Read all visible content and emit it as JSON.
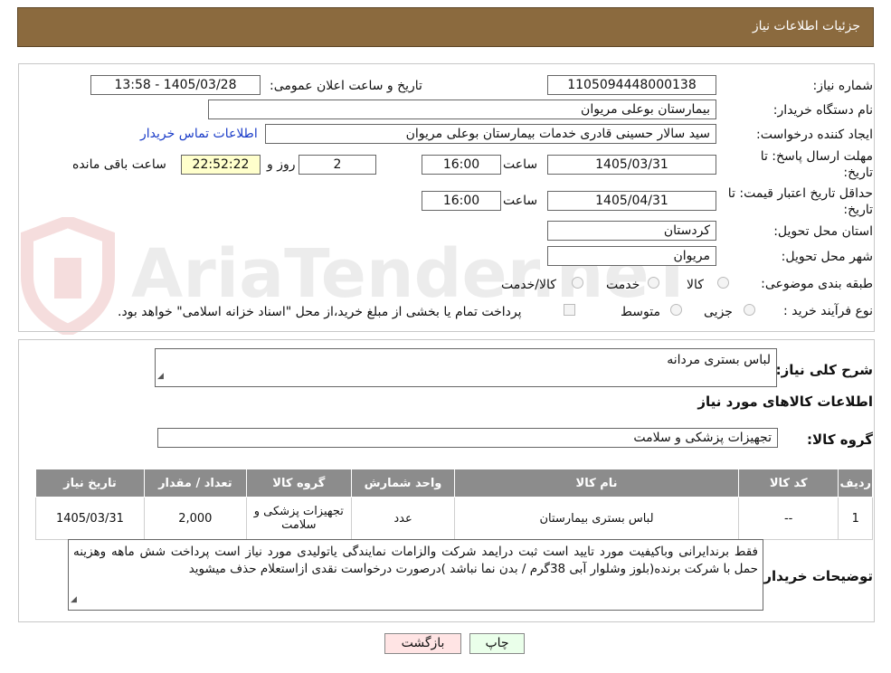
{
  "header": {
    "title": "جزئیات اطلاعات نیاز"
  },
  "watermark": {
    "text": "AriaTender.neT"
  },
  "form": {
    "need_number_label": "شماره نیاز:",
    "need_number": "1105094448000138",
    "announce_label": "تاریخ و ساعت اعلان عمومی:",
    "announce_value": "1405/03/28 - 13:58",
    "buyer_org_label": "نام دستگاه خریدار:",
    "buyer_org": "بیمارستان بوعلی مریوان",
    "requester_label": "ایجاد کننده درخواست:",
    "requester": "سید سالار حسینی قادری خدمات بیمارستان بوعلی مریوان",
    "contact_link": "اطلاعات تماس خریدار",
    "deadline_label_1": "مهلت ارسال پاسخ: تا",
    "deadline_label_2": "تاریخ:",
    "deadline_date": "1405/03/31",
    "time_label": "ساعت",
    "deadline_time": "16:00",
    "days_value": "2",
    "days_label": "روز و",
    "remaining_time": "22:52:22",
    "remaining_label": "ساعت باقی مانده",
    "validity_label_1": "حداقل تاریخ اعتبار قیمت: تا",
    "validity_label_2": "تاریخ:",
    "validity_date": "1405/04/31",
    "validity_time": "16:00",
    "province_label": "استان محل تحویل:",
    "province": "کردستان",
    "city_label": "شهر محل تحویل:",
    "city": "مریوان",
    "category_label": "طبقه بندی موضوعی:",
    "category_options": [
      "کالا",
      "خدمت",
      "کالا/خدمت"
    ],
    "process_label": "نوع فرآیند خرید :",
    "process_options": [
      "جزیی",
      "متوسط"
    ],
    "payment_note": "پرداخت تمام یا بخشی از مبلغ خرید،از محل \"اسناد خزانه اسلامی\" خواهد بود."
  },
  "summary": {
    "desc_label": "شرح کلی نیاز:",
    "desc_value": "لباس بستری مردانه",
    "goods_info_title": "اطلاعات کالاهای مورد نیاز",
    "group_label": "گروه کالا:",
    "group_value": "تجهیزات پزشکی و سلامت"
  },
  "table": {
    "headers": [
      "ردیف",
      "کد کالا",
      "نام کالا",
      "واحد شمارش",
      "گروه کالا",
      "تعداد / مقدار",
      "تاریخ نیاز"
    ],
    "rows": [
      [
        "1",
        "--",
        "لباس بستری بیمارستان",
        "عدد",
        "تجهیزات پزشکی و سلامت",
        "2,000",
        "1405/03/31"
      ]
    ]
  },
  "buyer_notes": {
    "label": "توضیحات خریدار:",
    "text": "فقط برندایرانی وباکیفیت مورد تایید است ثبت درایمد شرکت والزامات نمایندگی یاتولیدی مورد نیاز است پرداخت شش ماهه وهزینه حمل با شرکت برنده(بلوز وشلوار آبی 38گرم / بدن نما نباشد )درصورت درخواست نقدی ازاستعلام حذف میشوید"
  },
  "buttons": {
    "print": "چاپ",
    "back": "بازگشت"
  },
  "colors": {
    "header_bg": "#8b6a3e",
    "table_header_bg": "#8c8c8c",
    "time_bg": "#ffffcc",
    "back_bg": "#ffe4e4",
    "print_bg": "#eaffea",
    "link": "#1a3cc8"
  }
}
